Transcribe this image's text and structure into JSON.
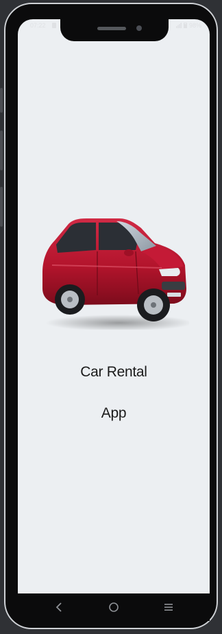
{
  "status_bar": {
    "time": "07:22",
    "battery": "98%"
  },
  "app": {
    "title_line1": "Car Rental",
    "title_line2": "App",
    "hero_image": "red-hatchback-car",
    "background_color": "#eceff2",
    "car_color": "#b3142c"
  },
  "navigation": {
    "back": "back-icon",
    "home": "home-icon",
    "recents": "recents-icon"
  }
}
